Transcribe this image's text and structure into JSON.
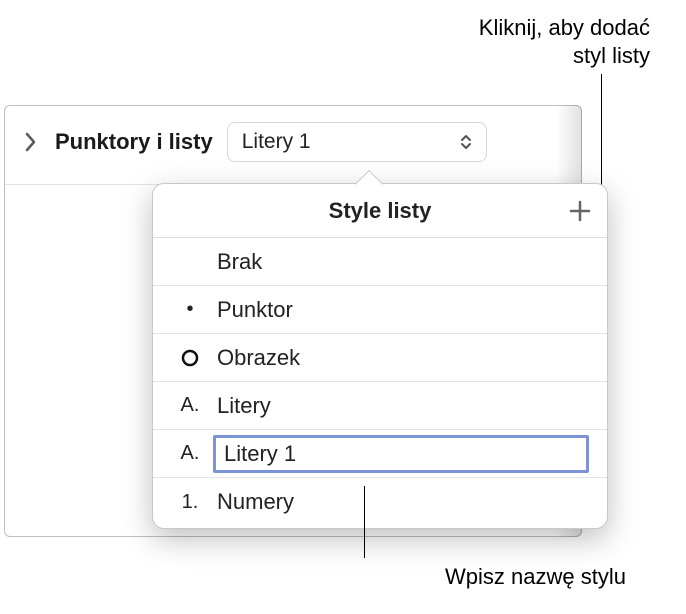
{
  "callouts": {
    "top": "Kliknij, aby dodać\nstyl listy",
    "bottom": "Wpisz nazwę stylu"
  },
  "section": {
    "label": "Punktory i listy",
    "dropdown_value": "Litery 1"
  },
  "popover": {
    "title": "Style listy",
    "items": [
      {
        "marker": "",
        "label": "Brak"
      },
      {
        "marker": "•",
        "label": "Punktor"
      },
      {
        "marker": "○",
        "label": "Obrazek"
      },
      {
        "marker": "A.",
        "label": "Litery"
      },
      {
        "marker": "A.",
        "label": "Litery 1",
        "editing": true
      },
      {
        "marker": "1.",
        "label": "Numery"
      }
    ]
  }
}
